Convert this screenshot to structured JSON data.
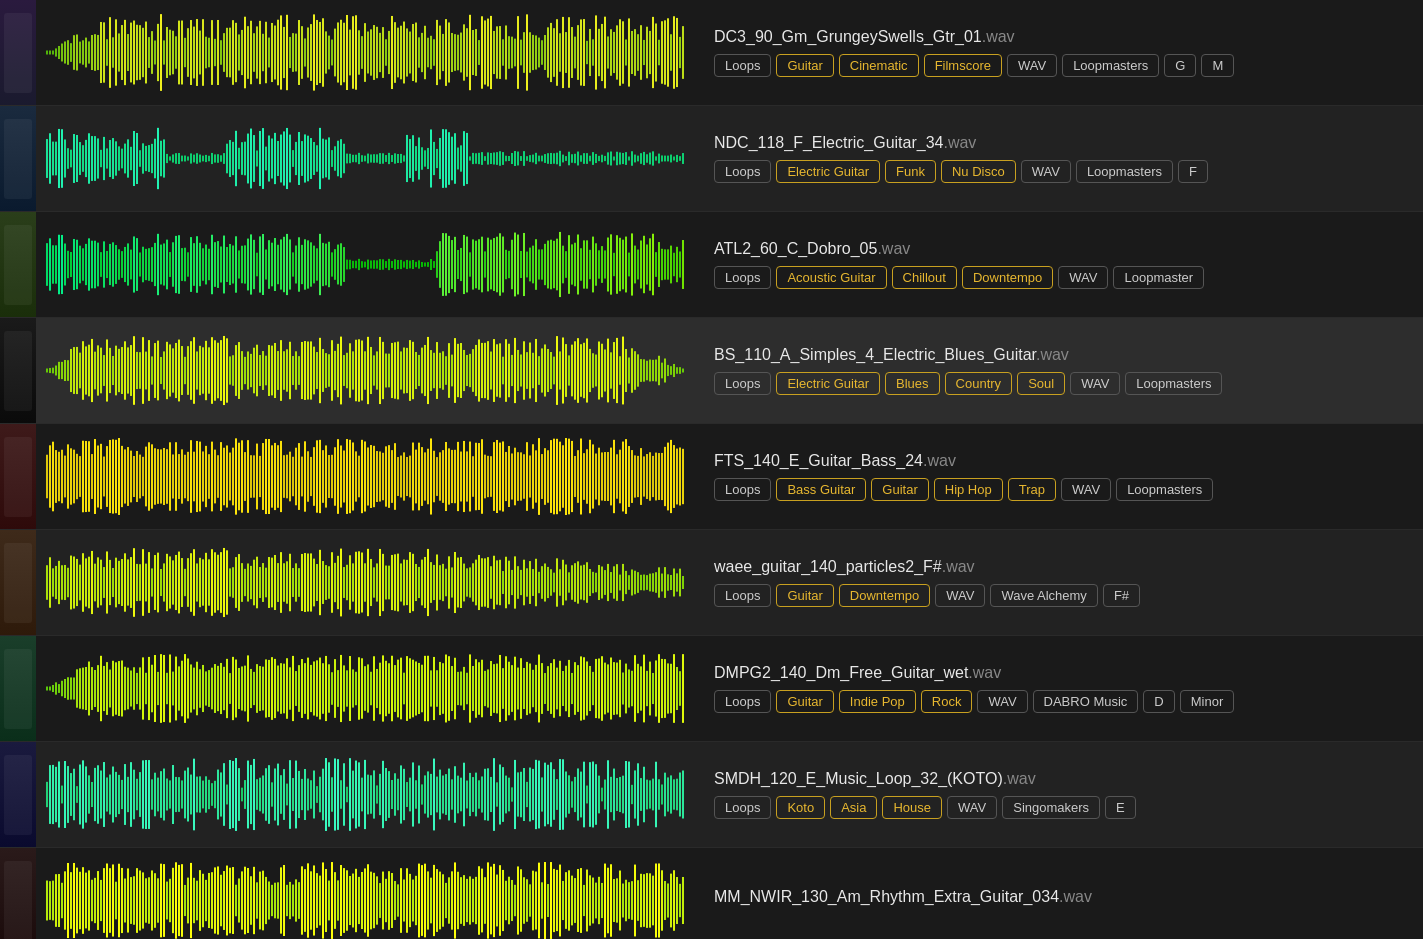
{
  "tracks": [
    {
      "id": 1,
      "thumb_class": "thumb-1",
      "name": "DC3_90_Gm_GrungeySwells_Gtr_01",
      "ext": ".wav",
      "waveform_style": "dense_choppy",
      "waveform_color": "yellow_green",
      "tags": [
        {
          "label": "Loops",
          "highlight": false
        },
        {
          "label": "Guitar",
          "highlight": true
        },
        {
          "label": "Cinematic",
          "highlight": true
        },
        {
          "label": "Filmscore",
          "highlight": true
        },
        {
          "label": "WAV",
          "highlight": false
        },
        {
          "label": "Loopmasters",
          "highlight": false
        },
        {
          "label": "G",
          "highlight": false
        },
        {
          "label": "M",
          "highlight": false
        }
      ]
    },
    {
      "id": 2,
      "thumb_class": "thumb-2",
      "name": "NDC_118_F_Electric_Guitar_34",
      "ext": ".wav",
      "waveform_style": "sparse_groups",
      "waveform_color": "cyan_green",
      "tags": [
        {
          "label": "Loops",
          "highlight": false
        },
        {
          "label": "Electric Guitar",
          "highlight": true
        },
        {
          "label": "Funk",
          "highlight": true
        },
        {
          "label": "Nu Disco",
          "highlight": true
        },
        {
          "label": "WAV",
          "highlight": false
        },
        {
          "label": "Loopmasters",
          "highlight": false
        },
        {
          "label": "F",
          "highlight": false
        }
      ]
    },
    {
      "id": 3,
      "thumb_class": "thumb-3",
      "name": "ATL2_60_C_Dobro_05",
      "ext": ".wav",
      "waveform_style": "sparse_medium",
      "waveform_color": "cyan_yellow_green",
      "tags": [
        {
          "label": "Loops",
          "highlight": false
        },
        {
          "label": "Acoustic Guitar",
          "highlight": true
        },
        {
          "label": "Chillout",
          "highlight": true
        },
        {
          "label": "Downtempo",
          "highlight": true
        },
        {
          "label": "WAV",
          "highlight": false
        },
        {
          "label": "Loopmaster",
          "highlight": false
        }
      ]
    },
    {
      "id": 4,
      "thumb_class": "thumb-4",
      "name": "BS_110_A_Simples_4_Electric_Blues_Guitar",
      "ext": ".wav",
      "waveform_style": "medium_dense",
      "waveform_color": "green_yellow",
      "tags": [
        {
          "label": "Loops",
          "highlight": false
        },
        {
          "label": "Electric Guitar",
          "highlight": true
        },
        {
          "label": "Blues",
          "highlight": true
        },
        {
          "label": "Country",
          "highlight": true
        },
        {
          "label": "Soul",
          "highlight": true
        },
        {
          "label": "WAV",
          "highlight": false
        },
        {
          "label": "Loopmasters",
          "highlight": false
        }
      ]
    },
    {
      "id": 5,
      "thumb_class": "thumb-5",
      "name": "FTS_140_E_Guitar_Bass_24",
      "ext": ".wav",
      "waveform_style": "full_dense",
      "waveform_color": "yellow_orange",
      "tags": [
        {
          "label": "Loops",
          "highlight": false
        },
        {
          "label": "Bass Guitar",
          "highlight": true
        },
        {
          "label": "Guitar",
          "highlight": true
        },
        {
          "label": "Hip Hop",
          "highlight": true
        },
        {
          "label": "Trap",
          "highlight": true
        },
        {
          "label": "WAV",
          "highlight": false
        },
        {
          "label": "Loopmasters",
          "highlight": false
        }
      ]
    },
    {
      "id": 6,
      "thumb_class": "thumb-6",
      "name": "waee_guitar_140_particles2_F#",
      "ext": ".wav",
      "waveform_style": "medium_taper",
      "waveform_color": "green_yellow",
      "tags": [
        {
          "label": "Loops",
          "highlight": false
        },
        {
          "label": "Guitar",
          "highlight": true
        },
        {
          "label": "Downtempo",
          "highlight": true
        },
        {
          "label": "WAV",
          "highlight": false
        },
        {
          "label": "Wave Alchemy",
          "highlight": false
        },
        {
          "label": "F#",
          "highlight": false
        }
      ]
    },
    {
      "id": 7,
      "thumb_class": "thumb-7",
      "name": "DMPG2_140_Dm_Free_Guitar_wet",
      "ext": ".wav",
      "waveform_style": "medium_dense2",
      "waveform_color": "yellow_green2",
      "tags": [
        {
          "label": "Loops",
          "highlight": false
        },
        {
          "label": "Guitar",
          "highlight": true
        },
        {
          "label": "Indie Pop",
          "highlight": true
        },
        {
          "label": "Rock",
          "highlight": true
        },
        {
          "label": "WAV",
          "highlight": false
        },
        {
          "label": "DABRO Music",
          "highlight": false
        },
        {
          "label": "D",
          "highlight": false
        },
        {
          "label": "Minor",
          "highlight": false
        }
      ]
    },
    {
      "id": 8,
      "thumb_class": "thumb-8",
      "name": "SMDH_120_E_Music_Loop_32_(KOTO)",
      "ext": ".wav",
      "waveform_style": "choppy_dense",
      "waveform_color": "cyan_green2",
      "tags": [
        {
          "label": "Loops",
          "highlight": false
        },
        {
          "label": "Koto",
          "highlight": true
        },
        {
          "label": "Asia",
          "highlight": true
        },
        {
          "label": "House",
          "highlight": true
        },
        {
          "label": "WAV",
          "highlight": false
        },
        {
          "label": "Singomakers",
          "highlight": false
        },
        {
          "label": "E",
          "highlight": false
        }
      ]
    },
    {
      "id": 9,
      "thumb_class": "thumb-9",
      "name": "MM_NWIR_130_Am_Rhythm_Extra_Guitar_034",
      "ext": ".wav",
      "waveform_style": "full_bottom",
      "waveform_color": "yellow_green3",
      "tags": []
    }
  ]
}
